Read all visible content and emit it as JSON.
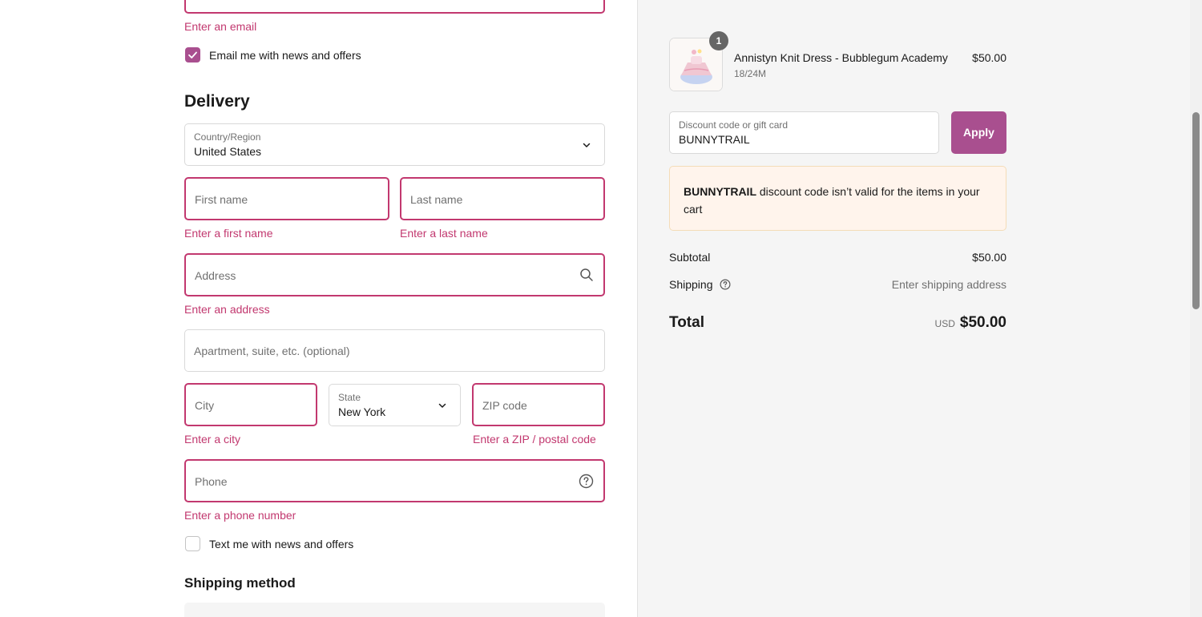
{
  "contact": {
    "email_error": "Enter an email",
    "email_news_label": "Email me with news and offers",
    "email_news_checked": true
  },
  "delivery": {
    "heading": "Delivery",
    "country_label": "Country/Region",
    "country_value": "United States",
    "first_name_placeholder": "First name",
    "first_name_error": "Enter a first name",
    "last_name_placeholder": "Last name",
    "last_name_error": "Enter a last name",
    "address_placeholder": "Address",
    "address_error": "Enter an address",
    "apartment_placeholder": "Apartment, suite, etc. (optional)",
    "city_placeholder": "City",
    "city_error": "Enter a city",
    "state_label": "State",
    "state_value": "New York",
    "zip_placeholder": "ZIP code",
    "zip_error": "Enter a ZIP / postal code",
    "phone_placeholder": "Phone",
    "phone_error": "Enter a phone number",
    "text_news_label": "Text me with news and offers",
    "text_news_checked": false
  },
  "shipping_method": {
    "heading": "Shipping method"
  },
  "order_summary": {
    "item": {
      "quantity": "1",
      "name": "Annistyn Knit Dress - Bubblegum Academy",
      "variant": "18/24M",
      "price": "$50.00"
    },
    "discount_label": "Discount code or gift card",
    "discount_value": "BUNNYTRAIL",
    "apply_label": "Apply",
    "alert_code": "BUNNYTRAIL",
    "alert_message": " discount code isn’t valid for the items in your cart",
    "subtotal_label": "Subtotal",
    "subtotal_value": "$50.00",
    "shipping_label": "Shipping",
    "shipping_value": "Enter shipping address",
    "total_label": "Total",
    "total_currency": "USD",
    "total_value": "$50.00"
  },
  "colors": {
    "accent": "#a94f8f",
    "error": "#c2386f",
    "alert_bg": "#fff4ec",
    "summary_bg": "#f5f5f5"
  },
  "icons": [
    "check-icon",
    "chevron-down-icon",
    "search-icon",
    "help-circle-icon"
  ]
}
